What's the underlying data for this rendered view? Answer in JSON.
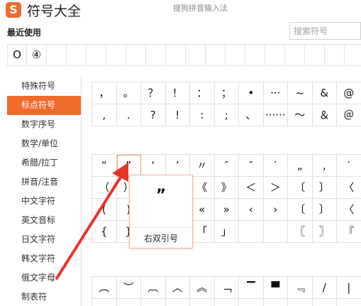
{
  "header": {
    "logo_letter": "S",
    "title": "符号大全",
    "subtitle": "搜狗拼音输入法"
  },
  "recent": {
    "title": "最近使用",
    "symbols": [
      "O",
      "④",
      "",
      "",
      "",
      "",
      "",
      "",
      "",
      "",
      "",
      "",
      "",
      "",
      "",
      "",
      ""
    ]
  },
  "search": {
    "placeholder": "搜索符号",
    "value": ""
  },
  "sidebar": {
    "items": [
      {
        "label": "特殊符号",
        "active": false
      },
      {
        "label": "标点符号",
        "active": true
      },
      {
        "label": "数字序号",
        "active": false
      },
      {
        "label": "数学/单位",
        "active": false
      },
      {
        "label": "希腊/拉丁",
        "active": false
      },
      {
        "label": "拼音/注音",
        "active": false
      },
      {
        "label": "中文字符",
        "active": false
      },
      {
        "label": "英文音标",
        "active": false
      },
      {
        "label": "日文字符",
        "active": false
      },
      {
        "label": "韩文字符",
        "active": false
      },
      {
        "label": "俄文字母",
        "active": false
      },
      {
        "label": "制表符",
        "active": false
      }
    ]
  },
  "grid1": [
    [
      "，",
      "。",
      "？",
      "！",
      "：",
      "；",
      "•",
      "···",
      "~",
      "&",
      "@"
    ],
    [
      ",",
      ".",
      "?",
      "!",
      ":",
      ";",
      "、",
      "······",
      "～",
      "＆",
      "＠"
    ]
  ],
  "grid2": [
    [
      "“",
      "”",
      "‘",
      "’",
      "〃",
      "″",
      "″",
      "′",
      "„",
      "‚",
      "′"
    ],
    [
      "（",
      "）",
      "",
      "",
      "《",
      "》",
      "＜",
      "＞",
      "〔",
      "〕",
      "〈"
    ],
    [
      "(",
      ")",
      "",
      "",
      "«",
      "»",
      "‹",
      "›",
      "〔",
      "〕",
      "〈"
    ],
    [
      "{",
      "}",
      "",
      "",
      "「",
      "」",
      "",
      "",
      "〖",
      "〗",
      "『"
    ]
  ],
  "grid3": [
    [
      "︵",
      "︶",
      "︹",
      "︿",
      "︽",
      "﹁",
      "▔",
      "▀",
      "﹃",
      "/",
      "|"
    ],
    [
      "",
      "",
      "",
      "",
      "",
      "",
      "",
      "",
      "",
      "",
      ""
    ]
  ],
  "popup": {
    "char": "”",
    "label": "右双引号"
  },
  "colors": {
    "accent": "#f06a2a",
    "arrow": "#e8332a"
  }
}
